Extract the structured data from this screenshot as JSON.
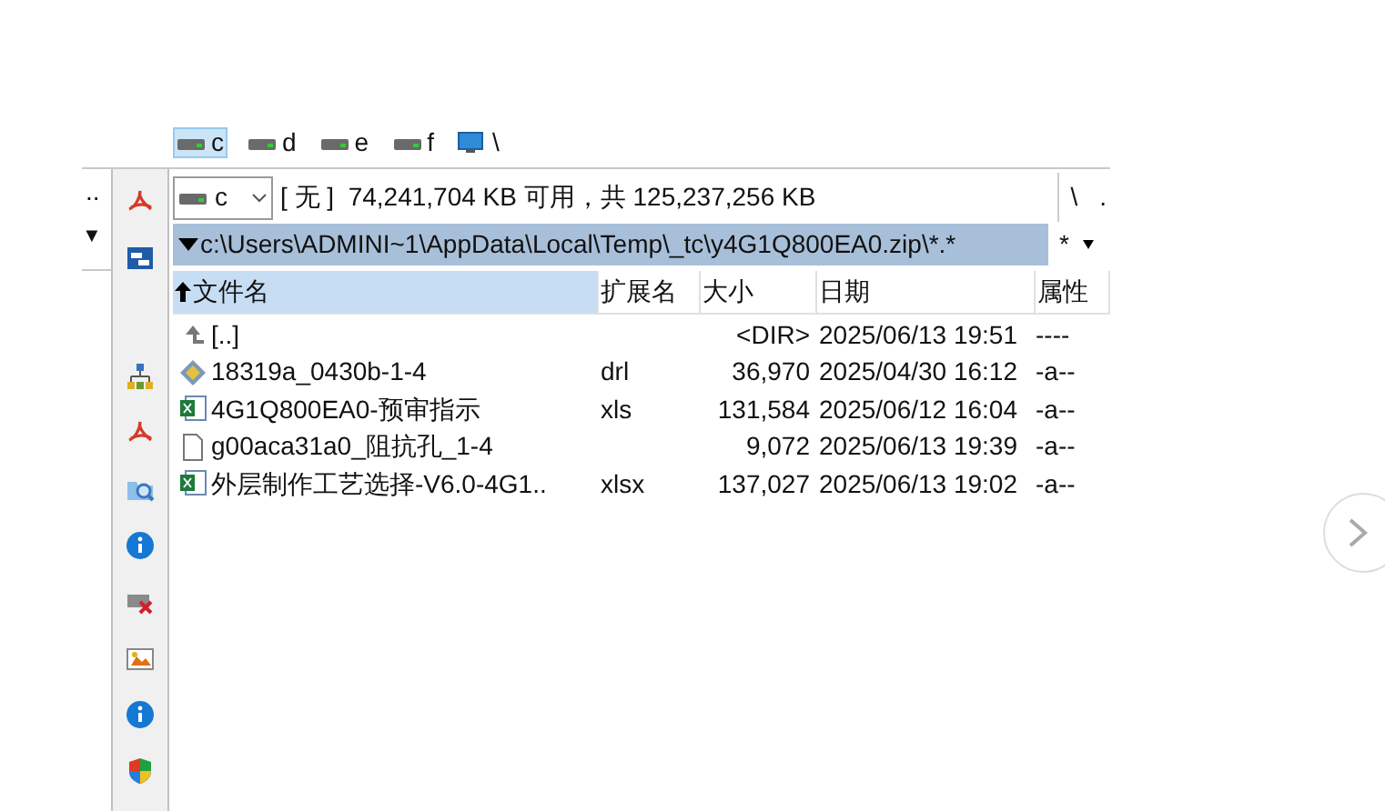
{
  "drives": [
    {
      "label": "c",
      "kind": "disk",
      "selected": true
    },
    {
      "label": "d",
      "kind": "disk",
      "selected": false
    },
    {
      "label": "e",
      "kind": "disk",
      "selected": false
    },
    {
      "label": "f",
      "kind": "disk",
      "selected": false
    },
    {
      "label": "\\",
      "kind": "network",
      "selected": false
    }
  ],
  "left_strip": {
    "dots": "..",
    "arrow": "▼"
  },
  "toolbar_groups": [
    [
      {
        "kind": "pdf"
      },
      {
        "kind": "window"
      }
    ],
    [
      {
        "kind": "tree"
      },
      {
        "kind": "pdf"
      },
      {
        "kind": "folder-search"
      },
      {
        "kind": "info"
      },
      {
        "kind": "drive-x"
      },
      {
        "kind": "image"
      },
      {
        "kind": "info"
      },
      {
        "kind": "shield"
      }
    ]
  ],
  "drive_bar": {
    "drive": "c",
    "info": "[ 无 ]  74,241,704 KB 可用，共 125,237,256 KB",
    "buttons": [
      "\\",
      "."
    ]
  },
  "path_bar": {
    "path": "c:\\Users\\ADMINI~1\\AppData\\Local\\Temp\\_tc\\y4G1Q800EA0.zip\\*.*",
    "filter": "*"
  },
  "columns": [
    {
      "label": "文件名",
      "sorted": true
    },
    {
      "label": "扩展名",
      "sorted": false
    },
    {
      "label": "大小",
      "sorted": false
    },
    {
      "label": "日期",
      "sorted": false
    },
    {
      "label": "属性",
      "sorted": false
    }
  ],
  "rows": [
    {
      "kind": "up",
      "name": "[..]",
      "size": "<DIR>",
      "date": "2025/06/13 19:51",
      "attr": "----"
    },
    {
      "kind": "drl",
      "name": "18319a_0430b-1-4",
      "ext": "drl",
      "size": "36,970",
      "date": "2025/04/30 16:12",
      "attr": "-a--"
    },
    {
      "kind": "excel",
      "name": "4G1Q800EA0-预审指示",
      "ext": "xls",
      "size": "131,584",
      "date": "2025/06/12 16:04",
      "attr": "-a--"
    },
    {
      "kind": "file",
      "name": "g00aca31a0_阻抗孔_1-4",
      "size": "9,072",
      "date": "2025/06/13 19:39",
      "attr": "-a--"
    },
    {
      "kind": "excel",
      "name": "外层制作工艺选择-V6.0-4G1..",
      "ext": "xlsx",
      "size": "137,027",
      "date": "2025/06/13 19:02",
      "attr": "-a--"
    }
  ],
  "next_button": {
    "kind": "chevron"
  }
}
